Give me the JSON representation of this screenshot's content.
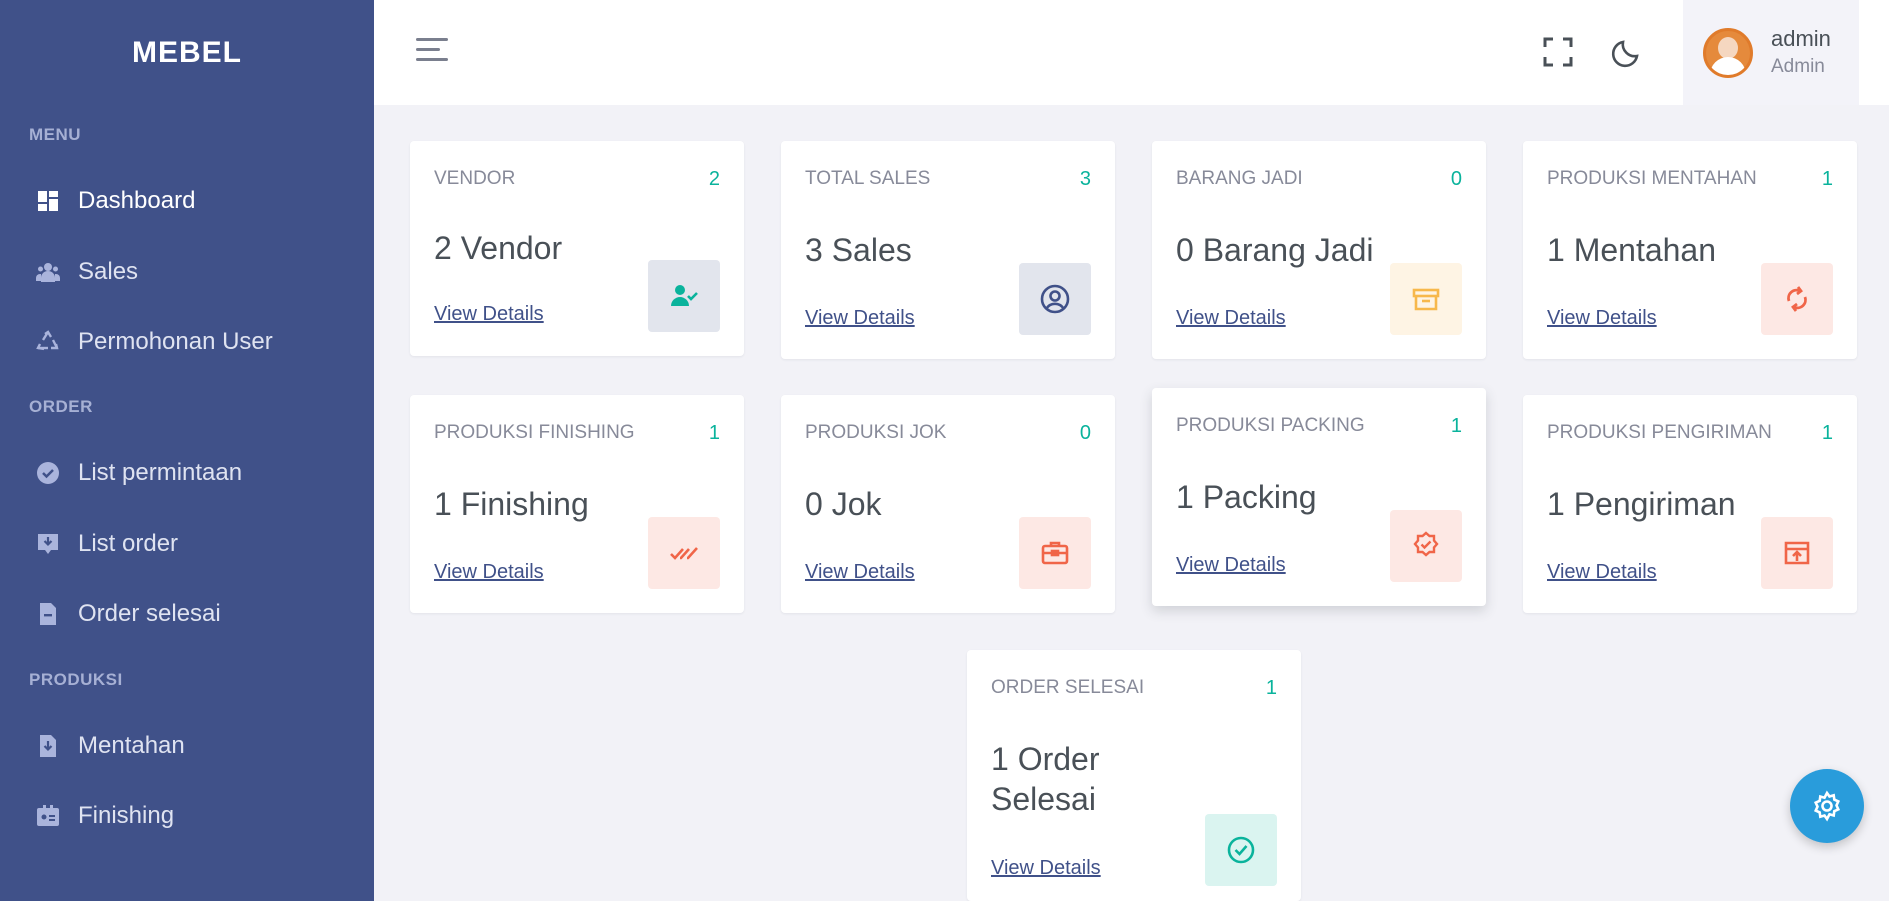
{
  "app": {
    "logo": "MEBEL"
  },
  "sidebar": {
    "sections": [
      {
        "title": "MENU"
      },
      {
        "title": "ORDER"
      },
      {
        "title": "PRODUKSI"
      }
    ],
    "items": [
      {
        "label": "Dashboard",
        "icon": "dashboard-icon"
      },
      {
        "label": "Sales",
        "icon": "users-icon"
      },
      {
        "label": "Permohonan User",
        "icon": "recycle-icon"
      },
      {
        "label": "List permintaan",
        "icon": "check-circle-icon"
      },
      {
        "label": "List order",
        "icon": "download-box-icon"
      },
      {
        "label": "Order selesai",
        "icon": "file-icon"
      },
      {
        "label": "Mentahan",
        "icon": "file-download-icon"
      },
      {
        "label": "Finishing",
        "icon": "id-card-icon"
      }
    ]
  },
  "topbar": {
    "user_name": "admin",
    "user_role": "Admin"
  },
  "cards": [
    {
      "label": "VENDOR",
      "count": "2",
      "value": "2 Vendor",
      "link": "View Details",
      "icon": "user-check-icon",
      "icon_bg": "#e2e5ed",
      "icon_color": "#0ab39c"
    },
    {
      "label": "TOTAL SALES",
      "count": "3",
      "value": "3 Sales",
      "link": "View Details",
      "icon": "user-circle-icon",
      "icon_bg": "#e2e5ed",
      "icon_color": "#405189"
    },
    {
      "label": "BARANG JADI",
      "count": "0",
      "value": "0 Barang Jadi",
      "link": "View Details",
      "icon": "archive-icon",
      "icon_bg": "#fef4e4",
      "icon_color": "#f7b84b"
    },
    {
      "label": "PRODUKSI MENTAHAN",
      "count": "1",
      "value": "1 Mentahan",
      "link": "View Details",
      "icon": "refresh-icon",
      "icon_bg": "#fde8e4",
      "icon_color": "#f06548"
    },
    {
      "label": "PRODUKSI FINISHING",
      "count": "1",
      "value": "1 Finishing",
      "link": "View Details",
      "icon": "double-check-icon",
      "icon_bg": "#fde8e4",
      "icon_color": "#f06548"
    },
    {
      "label": "PRODUKSI JOK",
      "count": "0",
      "value": "0 Jok",
      "link": "View Details",
      "icon": "briefcase-icon",
      "icon_bg": "#fde8e4",
      "icon_color": "#f06548"
    },
    {
      "label": "PRODUKSI PACKING",
      "count": "1",
      "value": "1 Packing",
      "link": "View Details",
      "icon": "badge-check-icon",
      "icon_bg": "#fde8e4",
      "icon_color": "#f06548"
    },
    {
      "label": "PRODUKSI PENGIRIMAN",
      "count": "1",
      "value": "1 Pengiriman",
      "link": "View Details",
      "icon": "archive-up-icon",
      "icon_bg": "#fde8e4",
      "icon_color": "#f06548"
    },
    {
      "label": "ORDER SELESAI",
      "count": "1",
      "value_line1": "1 Order",
      "value_line2": "Selesai",
      "link": "View Details",
      "icon": "check-circle-icon",
      "icon_bg": "#daf4f0",
      "icon_color": "#0ab39c"
    }
  ]
}
